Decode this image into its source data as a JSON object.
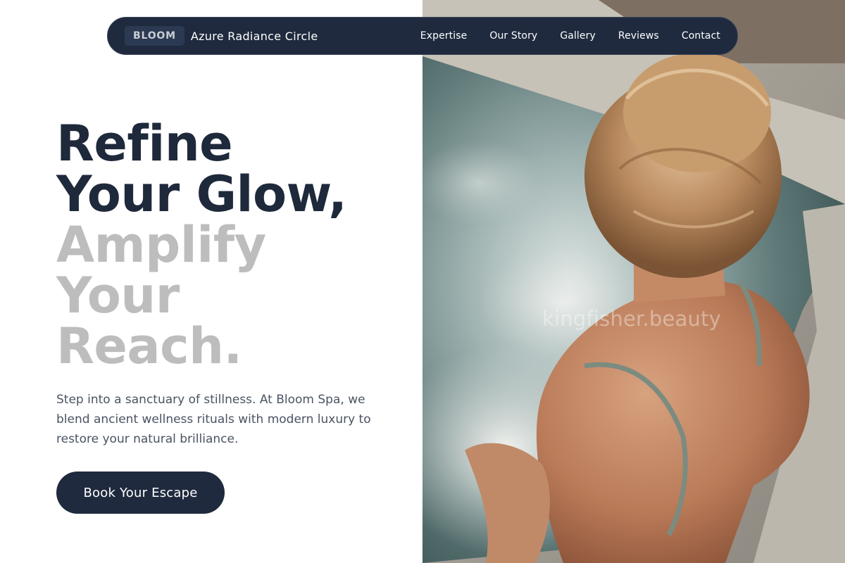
{
  "nav": {
    "logo": "BLOOM",
    "brand": "Azure Radiance Circle",
    "links": [
      "Expertise",
      "Our Story",
      "Gallery",
      "Reviews",
      "Contact"
    ]
  },
  "hero": {
    "headline_dark": [
      "Refine",
      "Your Glow,"
    ],
    "headline_light": [
      "Amplify",
      "Your",
      "Reach."
    ],
    "lede": "Step into a sanctuary of stillness. At Bloom Spa, we blend ancient wellness rituals with modern luxury to restore your natural brilliance.",
    "cta": "Book Your Escape"
  },
  "photo": {
    "watermark": "kingfisher.beauty"
  },
  "colors": {
    "navy": "#1f2a3e",
    "headline_dark": "#1e293b",
    "headline_light": "#bdbdbd"
  }
}
